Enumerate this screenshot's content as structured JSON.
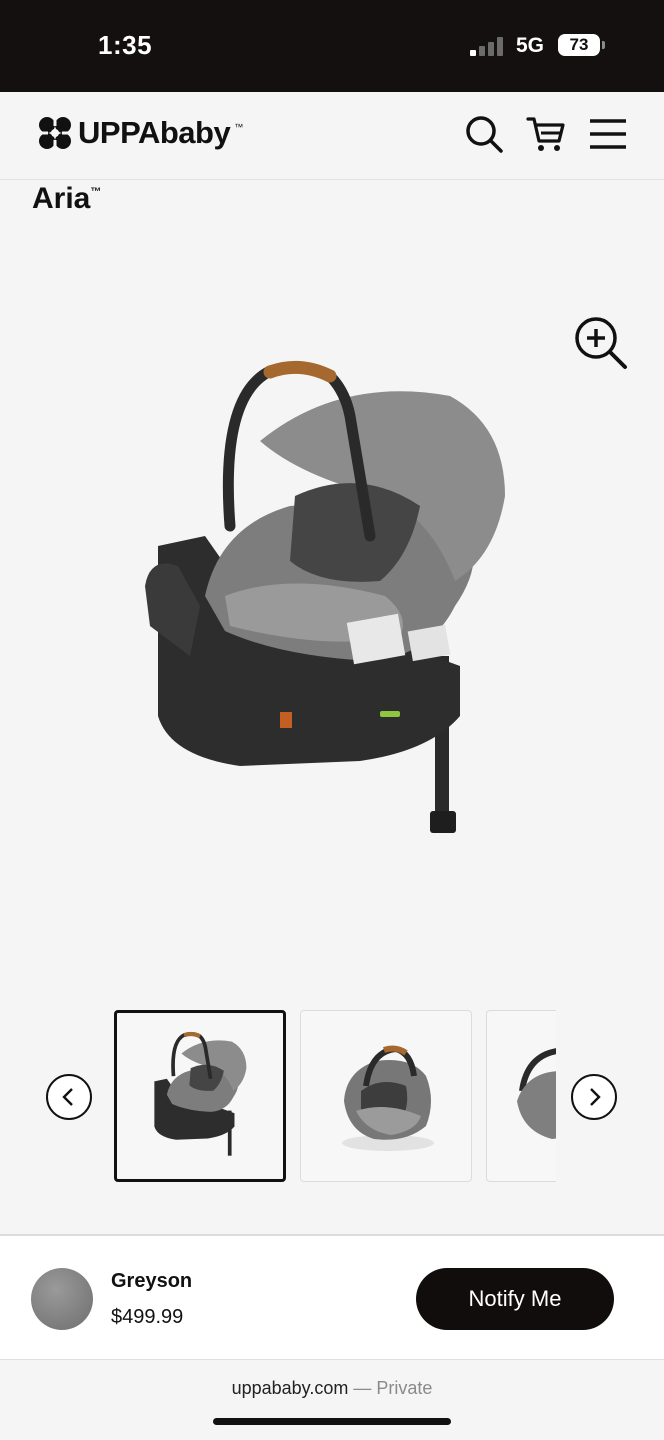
{
  "status_bar": {
    "time": "1:35",
    "network": "5G",
    "battery": "73"
  },
  "header": {
    "brand": "UPPAbaby",
    "trademark": "™",
    "icons": [
      "search-icon",
      "cart-icon",
      "menu-icon"
    ]
  },
  "product": {
    "name": "Aria",
    "trademark": "™"
  },
  "gallery": {
    "icons": [
      "zoom-in-icon",
      "chevron-left-icon",
      "chevron-right-icon"
    ]
  },
  "sticky_bar": {
    "color_name": "Greyson",
    "price": "$499.99",
    "notify_label": "Notify Me",
    "swatch_color": "#808080"
  },
  "browser": {
    "domain": "uppababy.com",
    "separator": "—",
    "mode": "Private"
  },
  "colors": {
    "dark": "#141010",
    "button": "#120d0d",
    "background": "#f5f5f5"
  }
}
